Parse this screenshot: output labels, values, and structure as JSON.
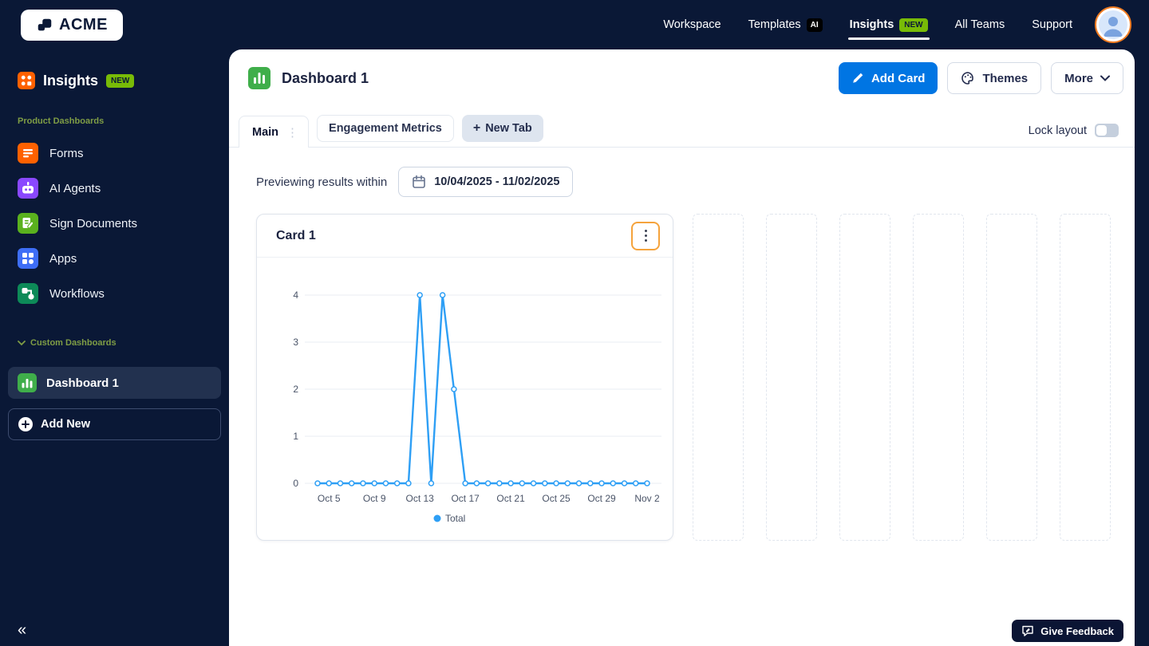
{
  "topbar": {
    "logo_text": "ACME",
    "nav": [
      {
        "label": "Workspace"
      },
      {
        "label": "Templates",
        "badge": "AI"
      },
      {
        "label": "Insights",
        "badge": "NEW"
      },
      {
        "label": "All Teams"
      },
      {
        "label": "Support"
      }
    ]
  },
  "sidebar": {
    "title": "Insights",
    "title_badge": "NEW",
    "section_product": "Product Dashboards",
    "items": [
      {
        "label": "Forms",
        "icon": "forms-icon",
        "color": "#ff6100"
      },
      {
        "label": "AI Agents",
        "icon": "ai-agents-icon",
        "color": "#8a48ff"
      },
      {
        "label": "Sign Documents",
        "icon": "sign-documents-icon",
        "color": "#5ab11e"
      },
      {
        "label": "Apps",
        "icon": "apps-icon",
        "color": "#3e6ef6"
      },
      {
        "label": "Workflows",
        "icon": "workflows-icon",
        "color": "#0d8a58"
      }
    ],
    "section_custom": "Custom Dashboards",
    "custom_items": [
      {
        "label": "Dashboard 1",
        "selected": true
      }
    ],
    "add_new_label": "Add New",
    "collapse_glyph": "«"
  },
  "main": {
    "title": "Dashboard 1",
    "add_card_label": "Add Card",
    "themes_label": "Themes",
    "more_label": "More",
    "tabs": [
      {
        "label": "Main",
        "active": true
      },
      {
        "label": "Engagement Metrics"
      },
      {
        "label": "New Tab"
      }
    ],
    "new_tab_plus": "+",
    "tab_menu_glyph": "⋮",
    "lock_layout_label": "Lock layout",
    "lock_layout_on": false,
    "preview_label": "Previewing results within",
    "date_range": "10/04/2025 - 11/02/2025",
    "feedback_label": "Give Feedback"
  },
  "card": {
    "title": "Card 1"
  },
  "chart_data": {
    "type": "line",
    "title": "Card 1",
    "x": [
      "Oct 4",
      "Oct 5",
      "Oct 6",
      "Oct 7",
      "Oct 8",
      "Oct 9",
      "Oct 10",
      "Oct 11",
      "Oct 12",
      "Oct 13",
      "Oct 14",
      "Oct 15",
      "Oct 16",
      "Oct 17",
      "Oct 18",
      "Oct 19",
      "Oct 20",
      "Oct 21",
      "Oct 22",
      "Oct 23",
      "Oct 24",
      "Oct 25",
      "Oct 26",
      "Oct 27",
      "Oct 28",
      "Oct 29",
      "Oct 30",
      "Oct 31",
      "Nov 1",
      "Nov 2"
    ],
    "series": [
      {
        "name": "Total",
        "values": [
          0,
          0,
          0,
          0,
          0,
          0,
          0,
          0,
          0,
          4,
          0,
          4,
          2,
          0,
          0,
          0,
          0,
          0,
          0,
          0,
          0,
          0,
          0,
          0,
          0,
          0,
          0,
          0,
          0,
          0
        ]
      }
    ],
    "x_tick_labels": [
      "Oct 5",
      "Oct 9",
      "Oct 13",
      "Oct 17",
      "Oct 21",
      "Oct 25",
      "Oct 29",
      "Nov 2"
    ],
    "y_ticks": [
      0,
      1,
      2,
      3,
      4
    ],
    "ylim": [
      0,
      4
    ],
    "legend": [
      "Total"
    ],
    "legend_position": "bottom",
    "grid": true,
    "line_color": "#2e9ff5"
  },
  "colors": {
    "navy": "#0a1836",
    "accent_blue": "#0075e3",
    "badge_green": "#78bb07",
    "brand_orange": "#ff6100",
    "chart_line": "#2e9ff5",
    "focus_orange": "#f5a33c"
  }
}
